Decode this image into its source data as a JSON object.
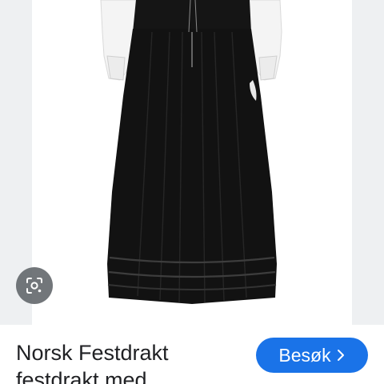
{
  "image": {
    "alt": "",
    "lens_icon": "google-lens-icon"
  },
  "result": {
    "title_line1": "Norsk Festdrakt",
    "title_line2": "festdrakt med"
  },
  "actions": {
    "visit_label": "Besøk",
    "visit_icon": "chevron-right-icon"
  },
  "colors": {
    "accent": "#1a73e8",
    "garment": "#121212",
    "blouse": "#f4f4f4",
    "panel_bg": "#eef0f2",
    "text": "#202124"
  }
}
